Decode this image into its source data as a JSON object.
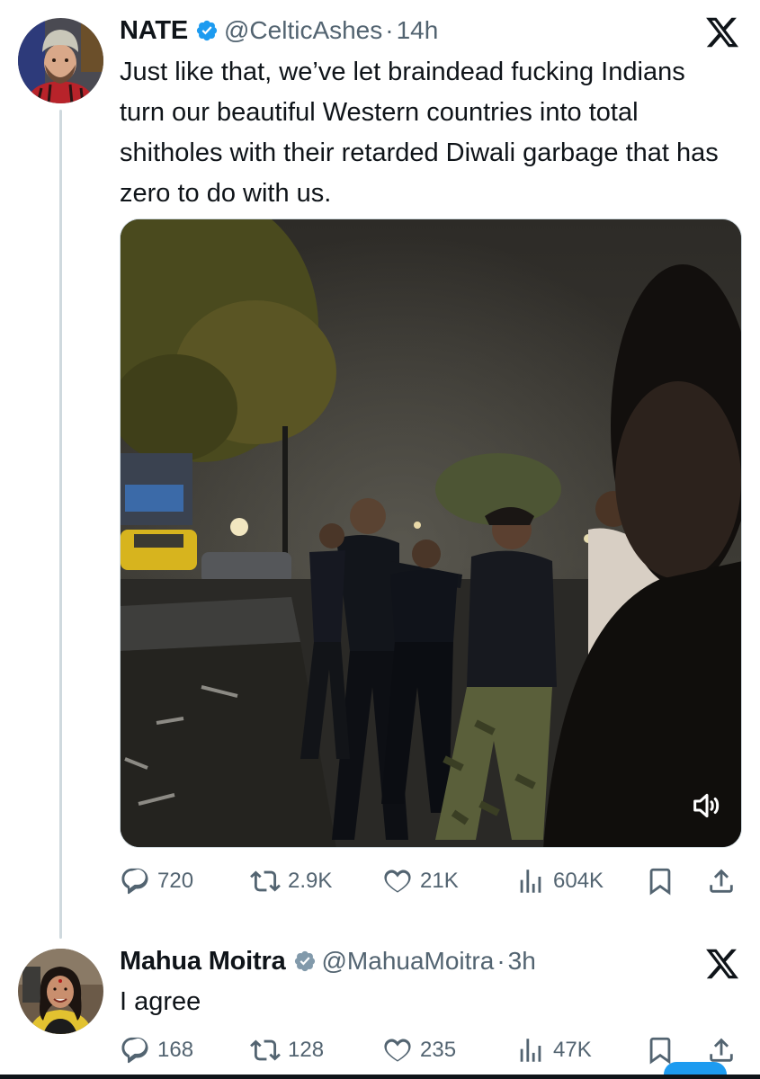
{
  "tweet": {
    "name": "NATE",
    "handle": "@CelticAshes",
    "separator": "·",
    "time": "14h",
    "text": "Just like that, we’ve let braindead fucking Indians turn our beautiful Western countries into total shitholes with their retarded Diwali garbage that has zero to do with us.",
    "stats": {
      "replies": "720",
      "reposts": "2.9K",
      "likes": "21K",
      "views": "604K"
    }
  },
  "reply": {
    "name": "Mahua Moitra",
    "handle": "@MahuaMoitra",
    "separator": "·",
    "time": "3h",
    "text": "I agree",
    "stats": {
      "replies": "168",
      "reposts": "128",
      "likes": "235",
      "views": "47K"
    }
  },
  "icons": {
    "verified": "verified-badge-icon",
    "brand": "x-logo-icon",
    "reply": "reply-icon",
    "repost": "repost-icon",
    "like": "heart-icon",
    "views": "views-icon",
    "bookmark": "bookmark-icon",
    "share": "share-icon",
    "volume": "volume-icon"
  },
  "colors": {
    "text": "#0f1419",
    "secondary": "#536471",
    "verified": "#1d9bf0",
    "thread_line": "#cfd9de"
  }
}
